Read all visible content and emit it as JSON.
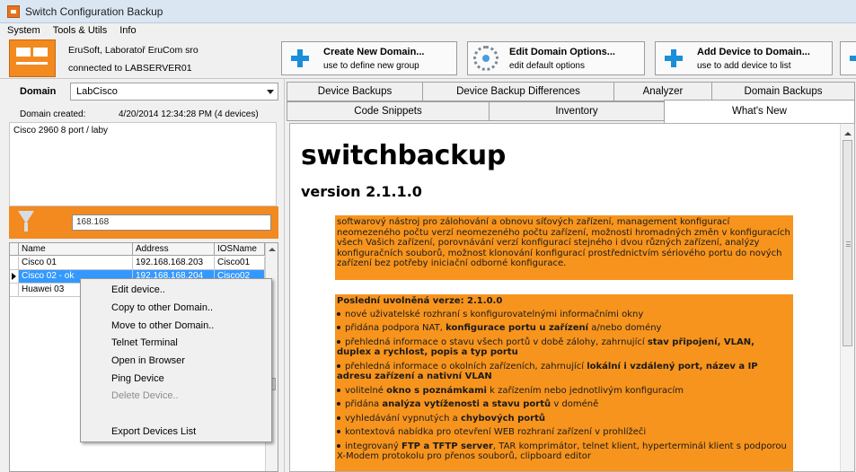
{
  "window": {
    "title": "Switch Configuration Backup"
  },
  "menu": {
    "items": [
      "System",
      "Tools & Utils",
      "Info"
    ]
  },
  "header": {
    "company": "EruSoft, Laboratoř EruCom sro",
    "connection": "connected to LABSERVER01"
  },
  "toolbar": {
    "buttons": [
      {
        "label": "Create New Domain...",
        "sub": "use to define new group",
        "icon": "plus-icon"
      },
      {
        "label": "Edit Domain Options...",
        "sub": "edit default options",
        "icon": "gear-icon"
      },
      {
        "label": "Add Device to Domain...",
        "sub": "use to add device to list",
        "icon": "plus-icon"
      }
    ]
  },
  "domain": {
    "label": "Domain",
    "selected": "LabCisco",
    "created_label": "Domain created:",
    "created_value": "4/20/2014 12:34:28 PM (4 devices)",
    "description": "Cisco 2960 8 port / laby"
  },
  "filter": {
    "value": "168.168",
    "icon": "funnel-icon"
  },
  "devices": {
    "columns": [
      "Name",
      "Address",
      "IOSName"
    ],
    "rows": [
      [
        "Cisco 01",
        "192.168.168.203",
        "Cisco01"
      ],
      [
        "Cisco 02 - ok",
        "192.168.168.204",
        "Cisco02"
      ],
      [
        "Huawei 03",
        "",
        ""
      ]
    ],
    "selected_index": 1
  },
  "context_menu": {
    "items": [
      {
        "label": "Edit device..",
        "enabled": true
      },
      {
        "label": "Copy to other Domain..",
        "enabled": true
      },
      {
        "label": "Move to other Domain..",
        "enabled": true
      },
      {
        "label": "Telnet Terminal",
        "enabled": true
      },
      {
        "label": "Open in Browser",
        "enabled": true
      },
      {
        "label": "Ping Device",
        "enabled": true
      },
      {
        "label": "Delete Device..",
        "enabled": false
      },
      {
        "label": "Export Devices List",
        "enabled": true
      }
    ]
  },
  "tabs": {
    "row1": [
      "Device Backups",
      "Device Backup Differences",
      "Analyzer",
      "Domain Backups"
    ],
    "row2": [
      "Code Snippets",
      "Inventory",
      "What's New"
    ],
    "active": "What's New"
  },
  "whats_new": {
    "title": "switchbackup",
    "version": "version 2.1.1.0",
    "intro": "softwarový nástroj pro zálohování a obnovu síťových zařízení, management konfigurací neomezeného počtu verzí neomezeného počtu zařízení, možnosti hromadných změn v konfiguracích všech Vašich zařízení, porovnávání verzí konfigurací stejného i dvou různých zařízení, analýzy konfiguračních souborů, možnost klonování konfigurací prostřednictvím sériového portu do nových zařízení bez potřeby iniciační odborné konfigurace.",
    "latest_heading": "Poslední uvolněná verze: 2.1.0.0",
    "bullets": [
      {
        "pre": "nové uživatelské rozhraní s konfigurovatelnými informačními okny",
        "bold": "",
        "post": ""
      },
      {
        "pre": "přidána podpora NAT, ",
        "bold": "konfigurace portu u zařízení",
        "post": " a/nebo domény"
      },
      {
        "pre": "přehledná informace o stavu všech portů v době zálohy, zahrnující ",
        "bold": "stav připojení, VLAN, duplex a rychlost, popis a typ portu",
        "post": ""
      },
      {
        "pre": "přehledná informace o okolních zařízeních, zahrnující ",
        "bold": "lokální i vzdálený port, název a IP adresu zařízení a nativní VLAN",
        "post": ""
      },
      {
        "pre": "volitelné ",
        "bold": "okno s poznámkami",
        "post": " k zařízením nebo jednotlivým konfiguracím"
      },
      {
        "pre": "přidána ",
        "bold": "analýza vytíženosti a stavu portů",
        "post": " v doméně"
      },
      {
        "pre": "vyhledávání vypnutých a ",
        "bold": "chybových portů",
        "post": ""
      },
      {
        "pre": "kontextová nabídka pro otevření WEB rozhraní zařízení v prohlížeči",
        "bold": "",
        "post": ""
      },
      {
        "pre": "integrovaný ",
        "bold": "FTP a TFTP server",
        "post": ", TAR komprimátor, telnet klient, hyperterminál klient s podporou X-Modem protokolu pro přenos souborů, clipboard editor"
      }
    ]
  },
  "colors": {
    "accent": "#f7941d",
    "selection": "#3399ff"
  }
}
